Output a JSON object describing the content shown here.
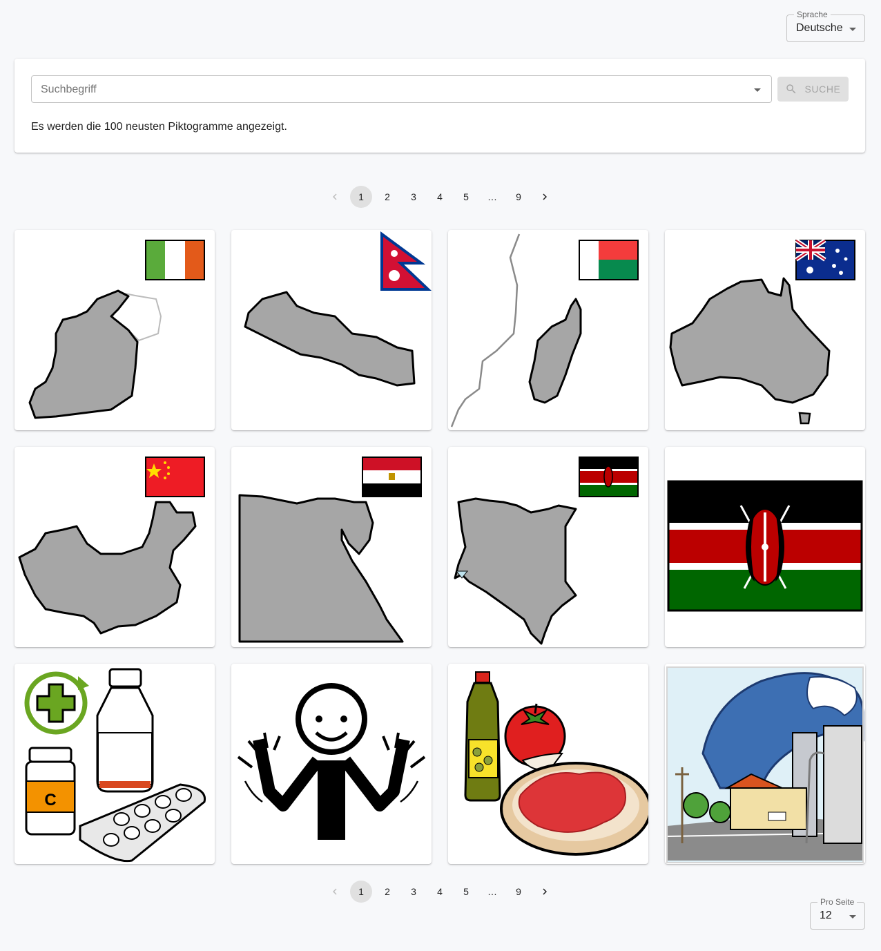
{
  "language_select": {
    "label": "Sprache",
    "value": "Deutsche"
  },
  "search": {
    "placeholder": "Suchbegriff",
    "button_label": "Suche",
    "info": "Es werden die 100 neusten Piktogramme angezeigt."
  },
  "pagination": {
    "pages": [
      "1",
      "2",
      "3",
      "4",
      "5",
      "…",
      "9"
    ],
    "current": "1"
  },
  "per_page": {
    "label": "Pro Seite",
    "value": "12"
  },
  "pictograms": [
    {
      "subject": "ireland-map-icon"
    },
    {
      "subject": "nepal-map-icon"
    },
    {
      "subject": "madagascar-map-icon"
    },
    {
      "subject": "australia-map-icon"
    },
    {
      "subject": "china-map-icon"
    },
    {
      "subject": "egypt-map-icon"
    },
    {
      "subject": "kenya-map-icon"
    },
    {
      "subject": "kenya-flag-icon"
    },
    {
      "subject": "medicine-icon"
    },
    {
      "subject": "happy-person-icon"
    },
    {
      "subject": "tomato-bread-icon"
    },
    {
      "subject": "tsunami-icon"
    }
  ],
  "colors": {
    "background": "#f7f8fa",
    "card": "#ffffff",
    "button_disabled_bg": "#e0e0e0",
    "button_disabled_text": "#a6a6a6",
    "page_active_bg": "#e0e0e0"
  }
}
